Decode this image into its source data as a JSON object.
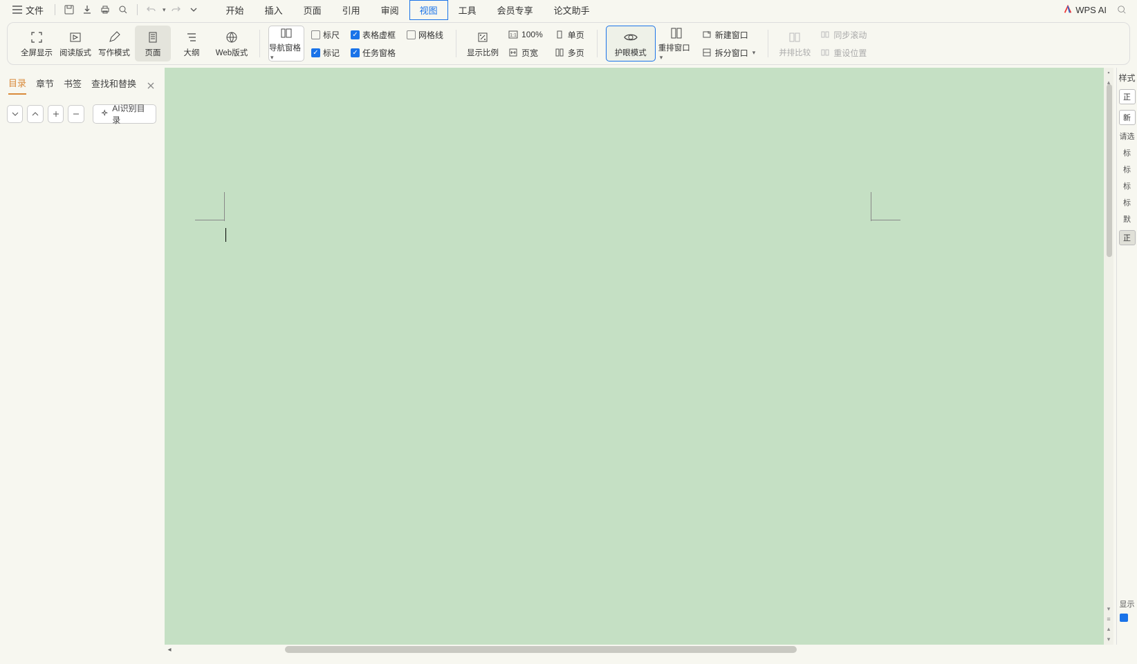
{
  "menubar": {
    "file": "文件",
    "tabs": [
      "开始",
      "插入",
      "页面",
      "引用",
      "审阅",
      "视图",
      "工具",
      "会员专享",
      "论文助手"
    ],
    "active_tab_index": 5,
    "wps_ai": "WPS AI"
  },
  "ribbon": {
    "fullscreen": "全屏显示",
    "reading": "阅读版式",
    "writing": "写作模式",
    "page": "页面",
    "outline": "大纲",
    "web": "Web版式",
    "nav_pane": "导航窗格",
    "ruler": "标尺",
    "table_frame": "表格虚框",
    "gridlines": "网格线",
    "markup": "标记",
    "taskpane": "任务窗格",
    "zoom_ratio": "显示比例",
    "zoom_100": "100%",
    "single_page": "单页",
    "page_width": "页宽",
    "multi_page": "多页",
    "eye_mode": "护眼模式",
    "rearrange": "重排窗口",
    "new_window": "新建窗口",
    "split_window": "拆分窗口",
    "side_by_side": "并排比较",
    "sync_scroll": "同步滚动",
    "reset_pos": "重设位置"
  },
  "sidenav": {
    "tabs": [
      "目录",
      "章节",
      "书签",
      "查找和替换"
    ],
    "active_index": 0,
    "ai_toc": "AI识别目录"
  },
  "stylepanel": {
    "header": "样式",
    "style_main": "正",
    "style_new": "新",
    "hint": "请选",
    "heading_prefix": "标",
    "default_prefix": "默",
    "body_prefix": "正",
    "show_label": "显示",
    "show_checked": true
  },
  "checks": {
    "ruler": false,
    "table_frame": true,
    "gridlines": false,
    "markup": true,
    "taskpane": true
  }
}
